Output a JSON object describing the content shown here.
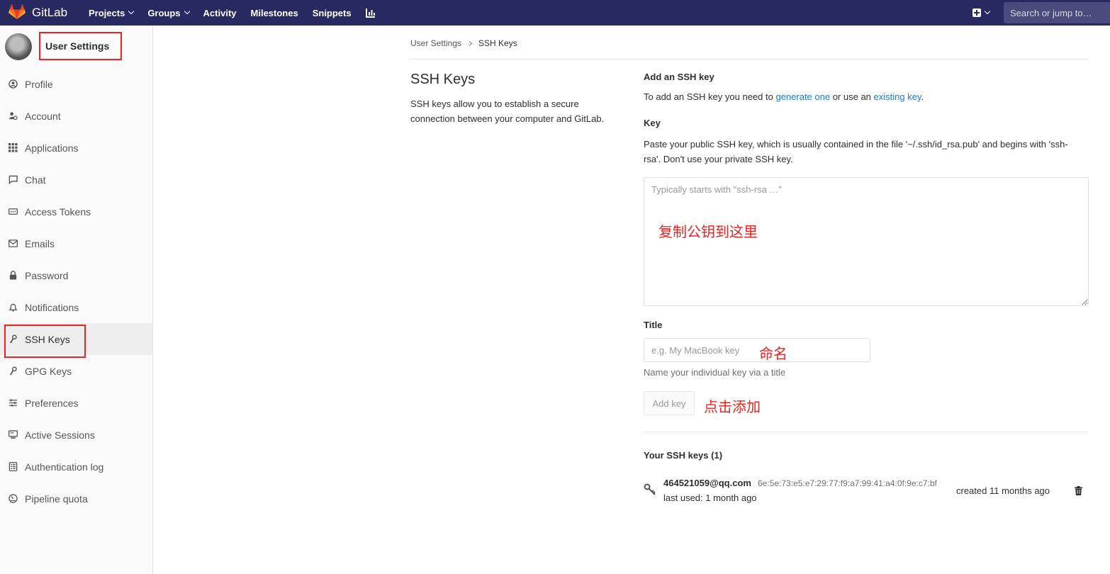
{
  "navbar": {
    "brand": "GitLab",
    "links": [
      {
        "label": "Projects",
        "caret": true
      },
      {
        "label": "Groups",
        "caret": true
      },
      {
        "label": "Activity",
        "caret": false
      },
      {
        "label": "Milestones",
        "caret": false
      },
      {
        "label": "Snippets",
        "caret": false
      }
    ],
    "chart_icon": "chart-icon",
    "search_placeholder": "Search or jump to…"
  },
  "sidebar": {
    "title": "User Settings",
    "items": [
      {
        "label": "Profile",
        "icon": "profile-icon"
      },
      {
        "label": "Account",
        "icon": "account-icon"
      },
      {
        "label": "Applications",
        "icon": "applications-icon"
      },
      {
        "label": "Chat",
        "icon": "chat-icon"
      },
      {
        "label": "Access Tokens",
        "icon": "token-icon"
      },
      {
        "label": "Emails",
        "icon": "email-icon"
      },
      {
        "label": "Password",
        "icon": "lock-icon"
      },
      {
        "label": "Notifications",
        "icon": "bell-icon"
      },
      {
        "label": "SSH Keys",
        "icon": "key-icon"
      },
      {
        "label": "GPG Keys",
        "icon": "key-icon"
      },
      {
        "label": "Preferences",
        "icon": "sliders-icon"
      },
      {
        "label": "Active Sessions",
        "icon": "monitor-icon"
      },
      {
        "label": "Authentication log",
        "icon": "log-icon"
      },
      {
        "label": "Pipeline quota",
        "icon": "quota-icon"
      }
    ]
  },
  "breadcrumb": {
    "parent": "User Settings",
    "current": "SSH Keys"
  },
  "page": {
    "title": "SSH Keys",
    "description": "SSH keys allow you to establish a secure connection between your computer and GitLab."
  },
  "form": {
    "add_heading": "Add an SSH key",
    "intro_prefix": "To add an SSH key you need to ",
    "intro_link1": "generate one",
    "intro_middle": " or use an ",
    "intro_link2": "existing key",
    "intro_suffix": ".",
    "key_label": "Key",
    "key_help": "Paste your public SSH key, which is usually contained in the file '~/.ssh/id_rsa.pub' and begins with 'ssh-rsa'. Don't use your private SSH key.",
    "key_placeholder": "Typically starts with \"ssh-rsa …\"",
    "key_value": "",
    "title_label": "Title",
    "title_placeholder": "e.g. My MacBook key",
    "title_value": "",
    "title_help": "Name your individual key via a title",
    "add_button": "Add key"
  },
  "annotations": {
    "key": "复制公钥到这里",
    "title": "命名",
    "add": "点击添加"
  },
  "keys_list": {
    "heading": "Your SSH keys (1)",
    "items": [
      {
        "title": "464521059@qq.com",
        "fingerprint": "6e:5e:73:e5:e7:29:77:f9:a7:99:41:a4:0f:9e:c7:bf",
        "last_used": "last used: 1 month ago",
        "created": "created 11 months ago"
      }
    ]
  },
  "colors": {
    "navbar": "#292961",
    "link": "#1f78d1",
    "annotation": "#ee2222"
  }
}
